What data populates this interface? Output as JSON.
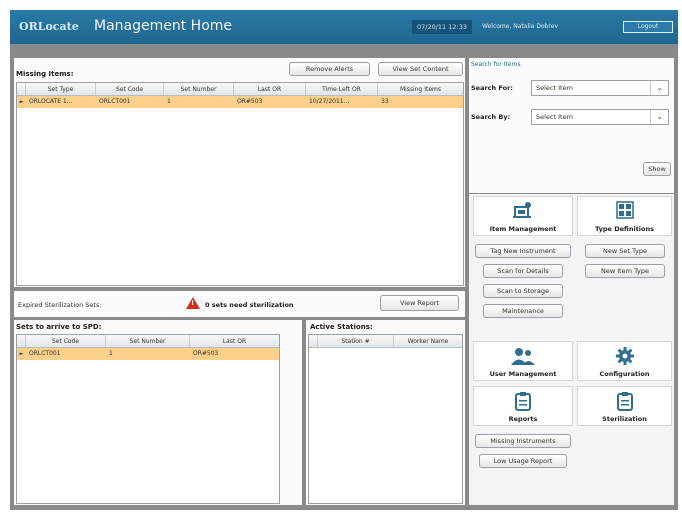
{
  "header": {
    "logo": "ORLocate",
    "title": "Management Home",
    "datetime": "07/20/11 12:33",
    "welcome": "Welcome, Natalia Dobrev",
    "logout_label": "Logout"
  },
  "missing_items": {
    "title": "Missing Items:",
    "remove_alerts_label": "Remove Alerts",
    "view_set_content_label": "View Set Content",
    "columns": [
      "Set Type",
      "Set Code",
      "Set Number",
      "Last OR",
      "Time Left OR",
      "Missing Items"
    ],
    "rows": [
      {
        "marker": "►",
        "set_type": "ORLOCATE 1...",
        "set_code": "ORLCT001",
        "set_number": "1",
        "last_or": "OR#503",
        "time_left_or": "10/27/2011...",
        "missing_items": "33"
      }
    ]
  },
  "search": {
    "title": "Search for Items",
    "search_for_label": "Search For:",
    "search_for_value": "Select Item",
    "search_by_label": "Search By:",
    "search_by_value": "Select Item",
    "show_label": "Show"
  },
  "expired": {
    "label": "Expired Sterilization Sets:",
    "alert_text": "0 sets need sterilization",
    "view_report_label": "View Report"
  },
  "sets_to_arrive": {
    "title": "Sets to arrive to SPD:",
    "columns": [
      "Set Code",
      "Set Number",
      "Last OR"
    ],
    "rows": [
      {
        "marker": "►",
        "set_code": "ORLCT001",
        "set_number": "1",
        "last_or": "OR#503"
      }
    ]
  },
  "active_stations": {
    "title": "Active Stations:",
    "columns": [
      "Station #",
      "Worker Name"
    ]
  },
  "item_management": {
    "label": "Item Management",
    "tag_new_instrument": "Tag New Instrument",
    "scan_for_details": "Scan for Details",
    "scan_to_storage": "Scan to Storage",
    "maintenance": "Maintenance"
  },
  "type_definitions": {
    "label": "Type Definitions",
    "new_set_type": "New Set Type",
    "new_item_type": "New Item Type"
  },
  "user_management": {
    "label": "User Management"
  },
  "configuration": {
    "label": "Configuration"
  },
  "reports": {
    "label": "Reports",
    "missing_instruments": "Missing Instruments",
    "low_usage_report": "Low Usage Report"
  },
  "sterilization": {
    "label": "Sterilization"
  },
  "colors": {
    "header_blue": "#1e6690",
    "row_highlight": "#fbd08a",
    "frame_gray": "#888a8c",
    "alert_red": "#d62d20",
    "icon_blue": "#2f6e8e"
  }
}
